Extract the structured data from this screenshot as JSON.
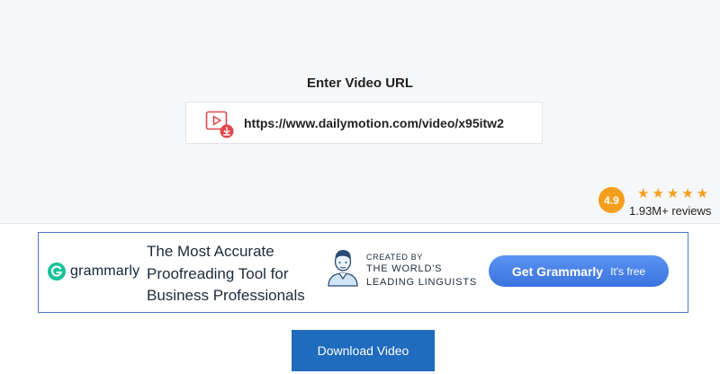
{
  "form": {
    "heading": "Enter Video URL",
    "url_value": "https://www.dailymotion.com/video/x95itw2",
    "url_icon": "video-download-icon"
  },
  "rating": {
    "score": "4.9",
    "stars": "★★★★★",
    "star_count": 5,
    "reviews": "1.93M+ reviews",
    "accent_color": "#f59e1c"
  },
  "ad": {
    "brand": "grammarly",
    "headline": [
      "The Most Accurate",
      "Proofreading Tool for",
      "Business Professionals"
    ],
    "created_by": "CREATED BY",
    "linguists": [
      "THE WORLD'S",
      "LEADING LINGUISTS"
    ],
    "cta_label": "Get Grammarly",
    "cta_sub": "It's free",
    "brand_color": "#15c39a",
    "cta_color": "#4a85e8"
  },
  "download": {
    "label": "Download Video",
    "color": "#1f6bbd"
  }
}
